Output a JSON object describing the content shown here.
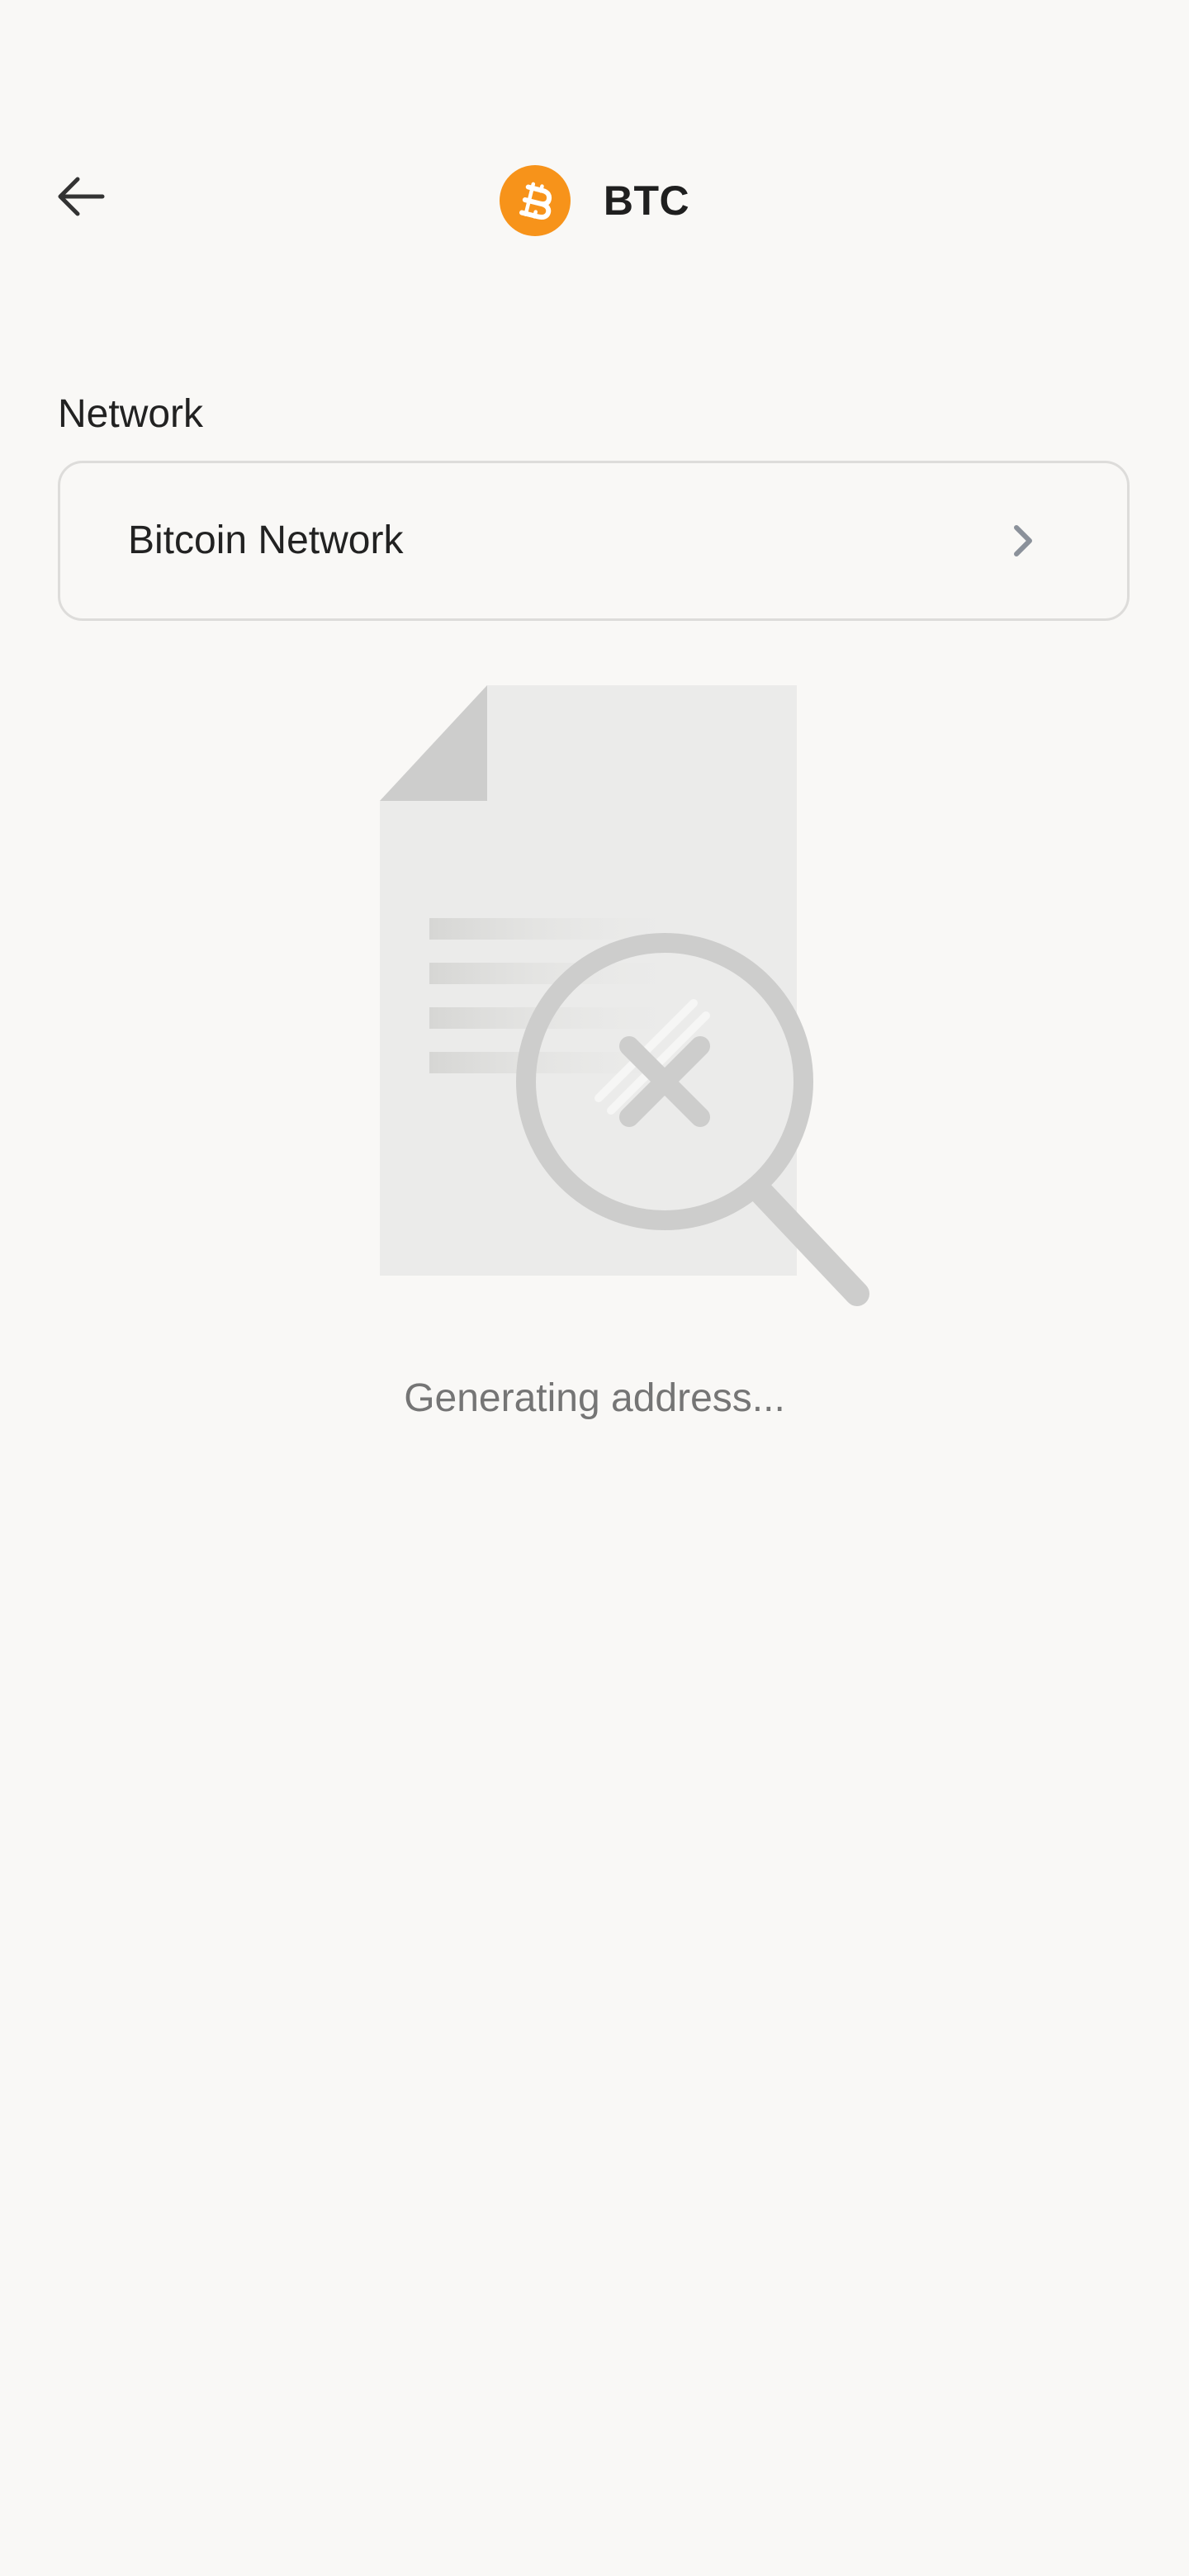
{
  "header": {
    "back_icon": "arrow-left-icon",
    "coin_icon": "bitcoin-icon",
    "coin_symbol": "BTC",
    "coin_color": "#f7931a"
  },
  "network": {
    "label": "Network",
    "selected": "Bitcoin Network",
    "chevron_icon": "chevron-right-icon"
  },
  "status": {
    "illustration_icon": "document-search-icon",
    "text": "Generating address..."
  }
}
